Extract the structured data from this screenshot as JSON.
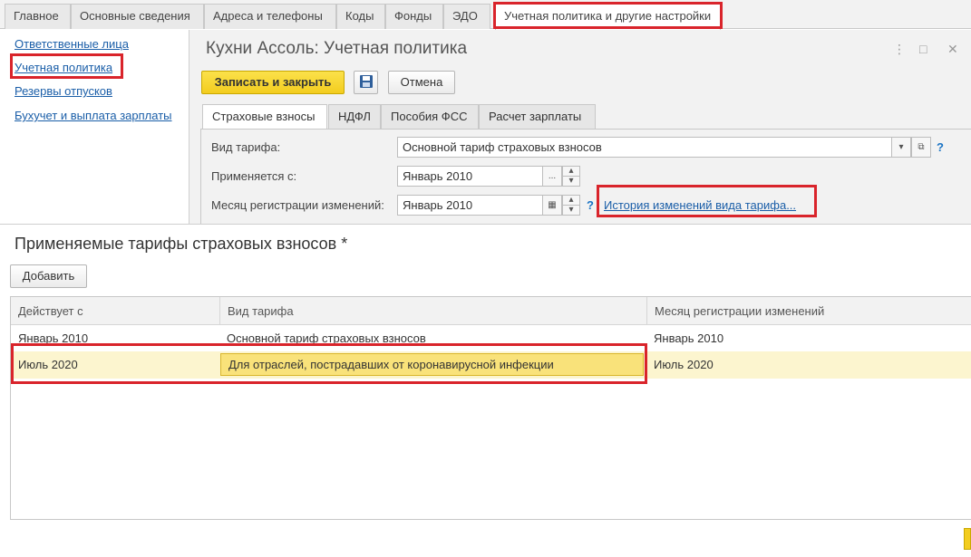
{
  "top_tabs": [
    {
      "label": "Главное"
    },
    {
      "label": "Основные сведения"
    },
    {
      "label": "Адреса и телефоны"
    },
    {
      "label": "Коды"
    },
    {
      "label": "Фонды"
    },
    {
      "label": "ЭДО"
    },
    {
      "label": "Учетная политика и другие настройки"
    }
  ],
  "left_nav": {
    "items": [
      {
        "label": "Ответственные лица"
      },
      {
        "label": "Учетная политика"
      },
      {
        "label": "Резервы отпусков"
      },
      {
        "label": "Бухучет и выплата зарплаты"
      }
    ]
  },
  "form": {
    "title": "Кухни Ассоль: Учетная политика",
    "window_controls": {
      "more": "⋮",
      "maximize": "□",
      "close": "✕"
    },
    "save_close_label": "Записать и закрыть",
    "cancel_label": "Отмена",
    "tabs": [
      {
        "label": "Страховые взносы"
      },
      {
        "label": "НДФЛ"
      },
      {
        "label": "Пособия ФСС"
      },
      {
        "label": "Расчет зарплаты"
      }
    ],
    "fields": {
      "tariff_label": "Вид тарифа:",
      "tariff_value": "Основной тариф страховых взносов",
      "applies_label": "Применяется с:",
      "applies_value": "Январь 2010",
      "reg_month_label": "Месяц регистрации изменений:",
      "reg_month_value": "Январь 2010",
      "history_link": "История изменений вида тарифа...",
      "help_mark": "?",
      "dots": "...",
      "dropdown_arrow": "▾",
      "open_icon": "⧉",
      "spin_up": "▴",
      "spin_down": "▾",
      "calendar_icon": "▦"
    }
  },
  "bottom": {
    "title": "Применяемые тарифы страховых взносов *",
    "add_label": "Добавить",
    "columns": [
      "Действует с",
      "Вид тарифа",
      "Месяц регистрации изменений"
    ],
    "rows": [
      [
        "Январь 2010",
        "Основной тариф страховых взносов",
        "Январь 2010"
      ],
      [
        "Июль 2020",
        "Для отраслей, пострадавших от коронавирусной инфекции",
        "Июль 2020"
      ]
    ]
  },
  "colors": {
    "highlight": "#d9242b",
    "primary_button": "#f3cd1f",
    "link": "#1a5ea8",
    "selected_row": "#fcf5cf"
  }
}
